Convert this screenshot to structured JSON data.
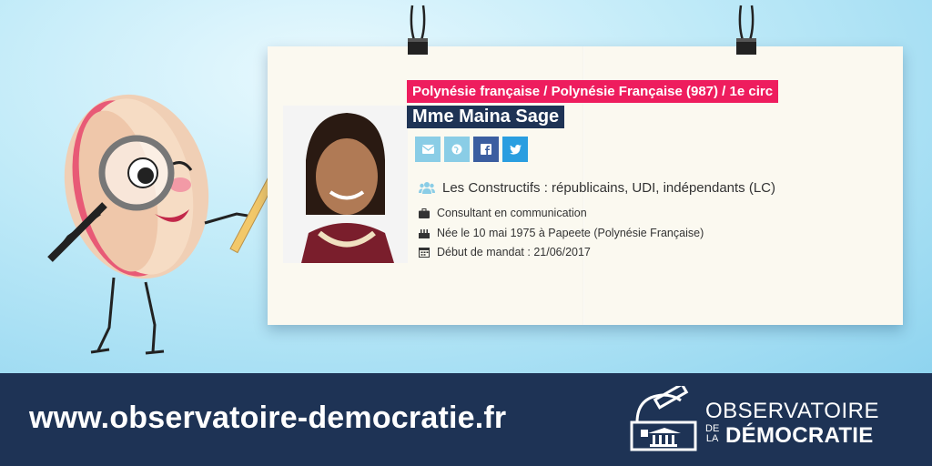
{
  "profile": {
    "circonscription": "Polynésie française / Polynésie Française (987) / 1e circ",
    "name": "Mme Maina Sage",
    "group": "Les Constructifs : républicains, UDI, indépendants (LC)",
    "profession": "Consultant en communication",
    "birth": "Née le 10 mai 1975 à Papeete (Polynésie Française)",
    "mandate_start": "Début de mandat : 21/06/2017"
  },
  "social": [
    "envelope-icon",
    "globe-icon",
    "facebook-icon",
    "twitter-icon"
  ],
  "footer": {
    "url": "www.observatoire-democratie.fr",
    "logo_line1": "OBSERVATOIRE",
    "logo_de": "DE",
    "logo_la": "LA",
    "logo_line2": "DÉMOCRATIE"
  },
  "colors": {
    "circ_bg": "#ee1d5e",
    "name_bg": "#1e3355",
    "footer_bg": "#1e3355",
    "mail_bg": "#8acde6",
    "facebook_bg": "#3b5ea0",
    "twitter_bg": "#2a9ee0"
  }
}
